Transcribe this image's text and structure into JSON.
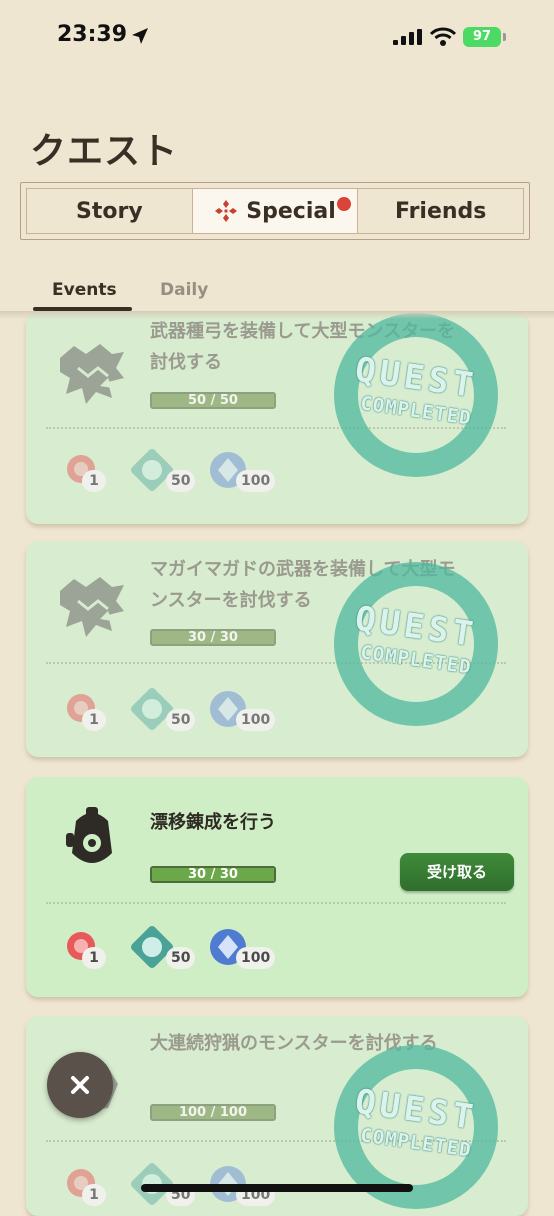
{
  "status_bar": {
    "time": "23:39",
    "battery": "97"
  },
  "page_title": "クエスト",
  "tabs": [
    {
      "label": "Story",
      "active": false
    },
    {
      "label": "Special",
      "active": true,
      "notification": true
    },
    {
      "label": "Friends",
      "active": false
    }
  ],
  "subtabs": [
    {
      "label": "Events",
      "active": true
    },
    {
      "label": "Daily",
      "active": false
    }
  ],
  "stamp": {
    "line1": "QUEST",
    "line2": "COMPLETED"
  },
  "quests": [
    {
      "title": "武器種弓を装備して大型モンスターを討伐する",
      "progress_text": "50 / 50",
      "progress": 1.0,
      "completed": true,
      "rewards": [
        "1",
        "50",
        "100"
      ]
    },
    {
      "title": "マガイマガドの武器を装備して大型モンスターを討伐する",
      "progress_text": "30 / 30",
      "progress": 1.0,
      "completed": true,
      "rewards": [
        "1",
        "50",
        "100"
      ]
    },
    {
      "title": "漂移錬成を行う",
      "progress_text": "30 / 30",
      "progress": 1.0,
      "completed": false,
      "claim_label": "受け取る",
      "rewards": [
        "1",
        "50",
        "100"
      ]
    },
    {
      "title": "大連続狩猟のモンスターを討伐する",
      "progress_text": "100 / 100",
      "progress": 1.0,
      "completed": true,
      "rewards": [
        "1",
        "50",
        "100"
      ]
    }
  ],
  "colors": {
    "background": "#efe6d2",
    "card": "#d8ecd0",
    "accent_red": "#d8433a",
    "claim_green": "#3f8b3a",
    "stamp_teal": "#2f8a7a"
  },
  "icons": [
    "location-arrow-icon",
    "signal-icon",
    "wifi-icon",
    "special-gem-icon",
    "monster-icon",
    "melding-pot-icon",
    "red-orb-icon",
    "armor-sphere-icon",
    "blue-gem-icon",
    "close-icon"
  ]
}
